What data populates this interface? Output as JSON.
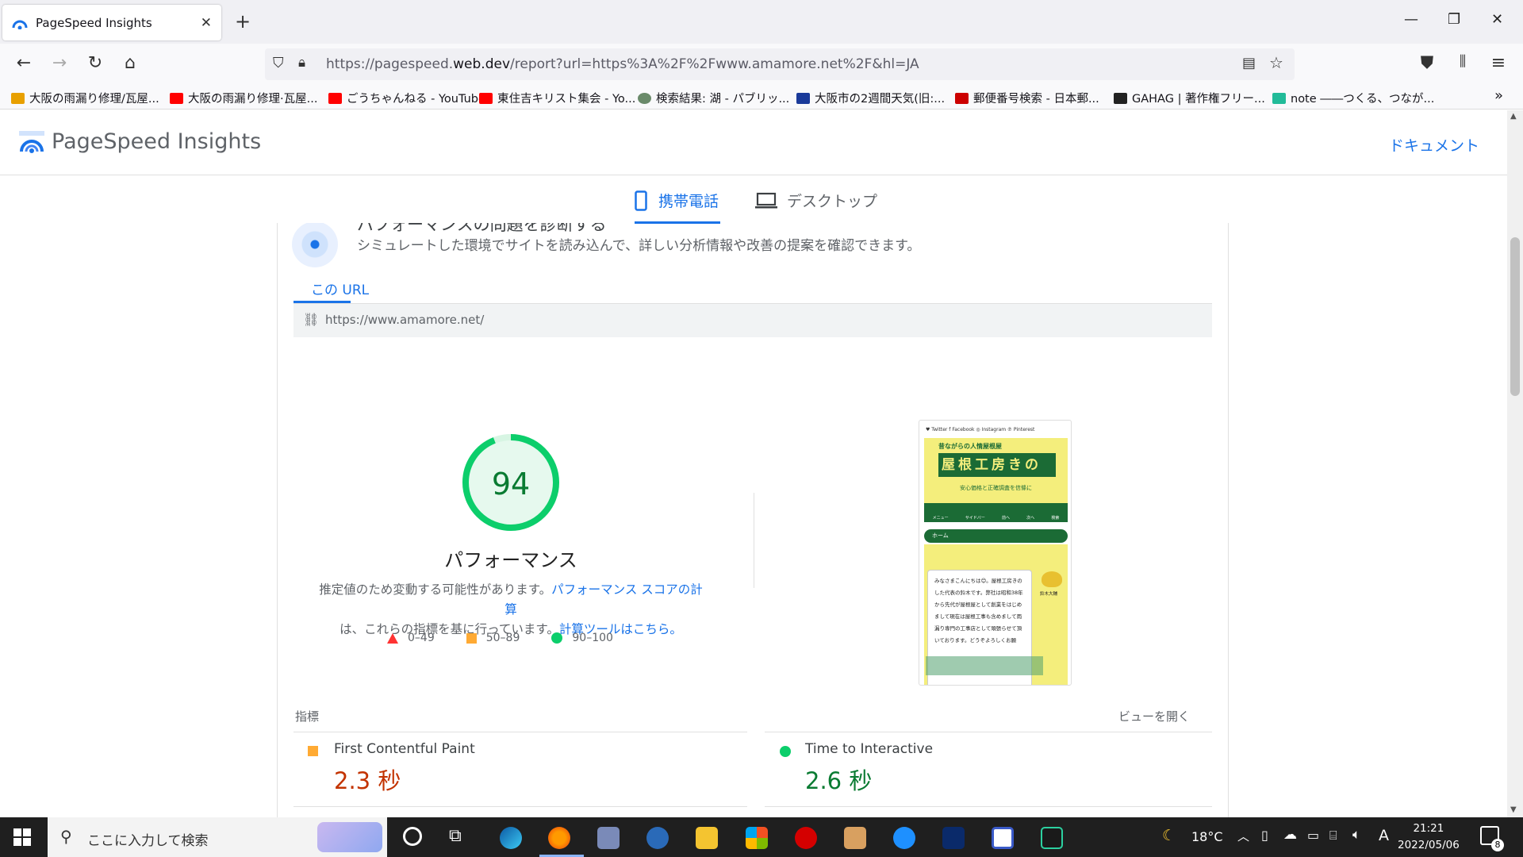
{
  "browser": {
    "tab_title": "PageSpeed Insights",
    "new_tab": "+",
    "url_prefix": "https://pagespeed.",
    "url_domain": "web.dev",
    "url_suffix": "/report?url=https%3A%2F%2Fwww.amamore.net%2F&hl=JA",
    "bookmarks": [
      {
        "label": "大阪の雨漏り修理/瓦屋...",
        "color": "#e8a000"
      },
      {
        "label": "大阪の雨漏り修理·瓦屋...",
        "color": "#ff0000"
      },
      {
        "label": "ごうちゃんねる - YouTube",
        "color": "#ff0000"
      },
      {
        "label": "東住吉キリスト集会 - Yo...",
        "color": "#ff0000"
      },
      {
        "label": "検索結果: 湖 - パブリッ...",
        "color": "#6a8a6a"
      },
      {
        "label": "大阪市の2週間天気(旧:...",
        "color": "#1a3a9a"
      },
      {
        "label": "郵便番号検索 - 日本郵...",
        "color": "#cc0000"
      },
      {
        "label": "GAHAG | 著作権フリー...",
        "color": "#222222"
      },
      {
        "label": "note ――つくる、つなが...",
        "color": "#22bb99"
      }
    ]
  },
  "psi": {
    "title": "PageSpeed Insights",
    "docs_link": "ドキュメント",
    "tab_mobile": "携帯電話",
    "tab_desktop": "デスクトップ",
    "diag_title": "パフォーマンスの問題を診断する",
    "diag_subtitle": "シミュレートした環境でサイトを読み込んで、詳しい分析情報や改善の提案を確認できます。",
    "url_tab": "この URL",
    "analyzed_url": "https://www.amamore.net/",
    "score": "94",
    "score_value": 94,
    "score_label": "パフォーマンス",
    "desc_1": "推定値のため変動する可能性があります。",
    "desc_link_1": "パフォーマンス スコアの計算",
    "desc_2": "は、これらの指標を基に行っています。",
    "desc_link_2": "計算ツールはこちら。",
    "legend": {
      "poor": "0–49",
      "average": "50–89",
      "good": "90–100"
    },
    "metrics_label": "指標",
    "view_open": "ビューを開く",
    "metrics": [
      {
        "name": "First Contentful Paint",
        "value": "2.3 秒",
        "status": "average",
        "color": "#c33300"
      },
      {
        "name": "Time to Interactive",
        "value": "2.6 秒",
        "status": "good",
        "color": "#0a7b32"
      }
    ]
  },
  "preview": {
    "social": "♥ Twitter  f Facebook  ◎ Instagram  ℗ Pinterest",
    "tagline_top": "昔ながらの人情屋根屋",
    "site_name": "屋根工房きのした",
    "tagline_sub": "安心価格と正確調査を信條に",
    "nav": [
      "メニュー",
      "サイドバー",
      "前へ",
      "次へ",
      "検索"
    ],
    "home": "ホーム",
    "person": "鈴木大輔",
    "greeting": "みなさまこんにちは😊。屋根工房きのした代表の鈴木です。弊社は昭和38年から先代が屋根屋として創業をはじめまして現在は屋根工事も含めまして雨漏り専門の工事店として頑張らせて頂いております。どうぞよろしくお願"
  },
  "taskbar": {
    "search_placeholder": "ここに入力して検索",
    "weather": "18°C",
    "ime": "A",
    "time": "21:21",
    "date": "2022/05/06",
    "notifications": "8"
  },
  "colors": {
    "accent": "#1a73e8",
    "good": "#0cce6b",
    "average": "#ffaa33",
    "poor": "#ff3333"
  }
}
